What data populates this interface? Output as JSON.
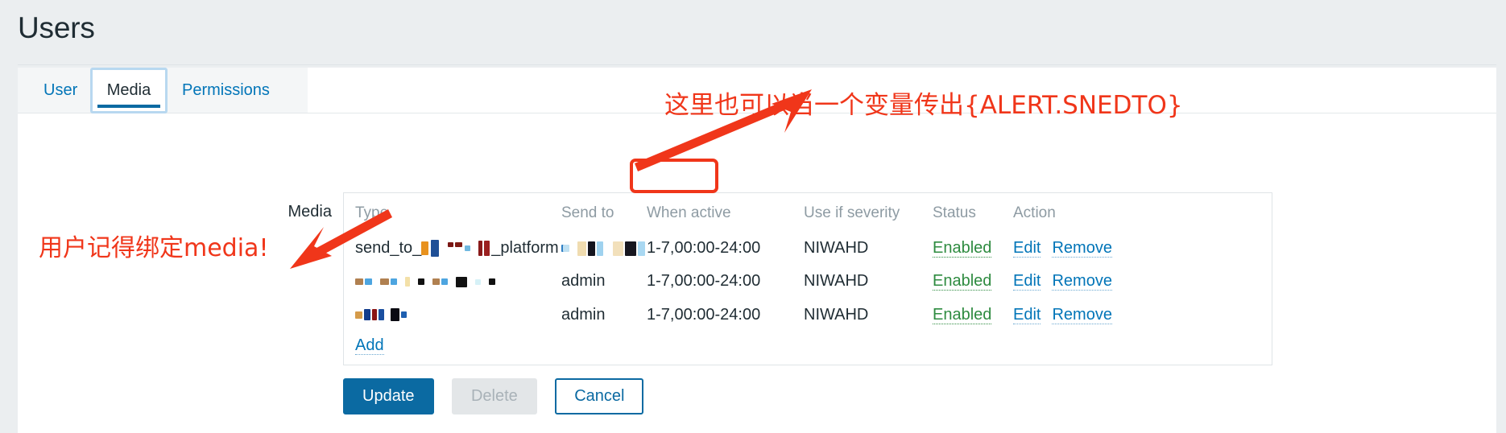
{
  "page": {
    "title": "Users"
  },
  "tabs": [
    {
      "id": "user",
      "label": "User",
      "active": false
    },
    {
      "id": "media",
      "label": "Media",
      "active": true
    },
    {
      "id": "permissions",
      "label": "Permissions",
      "active": false
    }
  ],
  "form": {
    "media_label": "Media"
  },
  "table": {
    "headers": {
      "type": "Type",
      "send_to": "Send to",
      "when_active": "When active",
      "use_if_severity": "Use if severity",
      "status": "Status",
      "action": "Action"
    },
    "rows": [
      {
        "type_prefix": "send_to_",
        "type_suffix": "_platform",
        "type_redacted": true,
        "send_to": "",
        "send_to_redacted": true,
        "when_active": "1-7,00:00-24:00",
        "use_if_severity": "NIWAHD",
        "status": "Enabled",
        "actions": [
          "Edit",
          "Remove"
        ]
      },
      {
        "type_prefix": "",
        "type_suffix": "",
        "type_redacted": true,
        "send_to": "admin",
        "send_to_redacted": false,
        "when_active": "1-7,00:00-24:00",
        "use_if_severity": "NIWAHD",
        "status": "Enabled",
        "actions": [
          "Edit",
          "Remove"
        ]
      },
      {
        "type_prefix": "",
        "type_suffix": "",
        "type_redacted": true,
        "send_to": "admin",
        "send_to_redacted": false,
        "when_active": "1-7,00:00-24:00",
        "use_if_severity": "NIWAHD",
        "status": "Enabled",
        "actions": [
          "Edit",
          "Remove"
        ]
      }
    ],
    "add_label": "Add"
  },
  "buttons": {
    "update": "Update",
    "delete": "Delete",
    "cancel": "Cancel"
  },
  "annotations": {
    "top_right": "这里也可以当一个变量传出{ALERT.SNEDTO}",
    "bottom_left": "用户记得绑定media!",
    "highlight_target": "Send to"
  },
  "colors": {
    "accent_blue": "#0275b8",
    "button_blue": "#0b6aa2",
    "severity_green": "#2e8b40",
    "annotation_red": "#f0361a",
    "page_bg": "#ebeef0",
    "header_gray": "#8e9ba3"
  }
}
